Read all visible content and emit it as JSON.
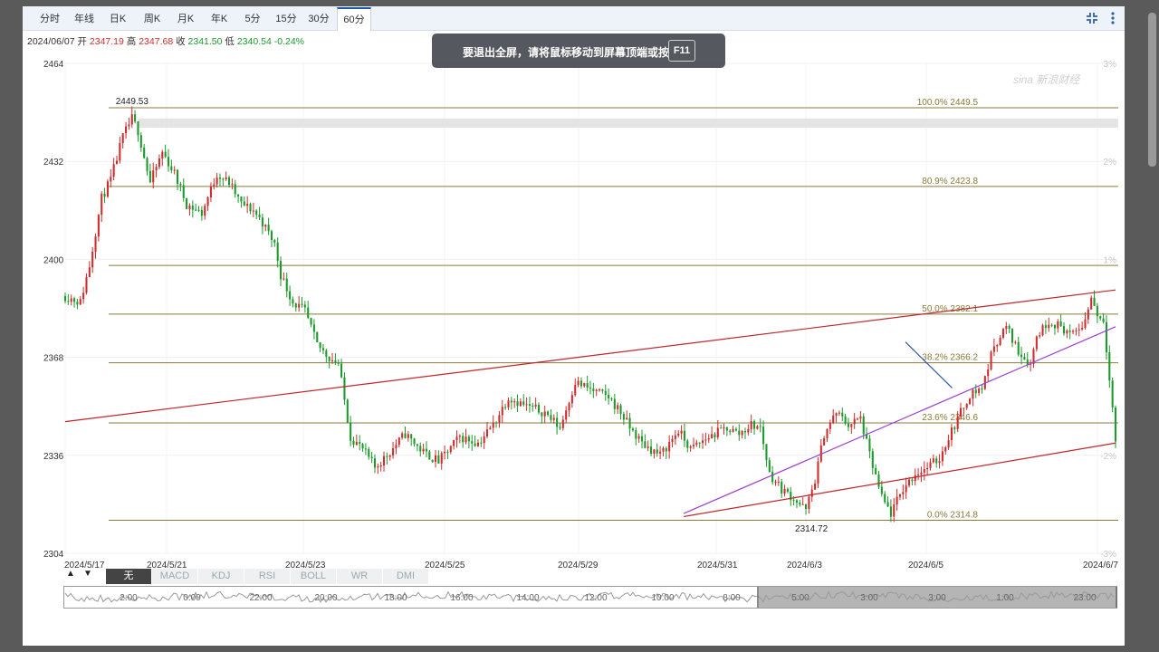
{
  "tabs": [
    {
      "label": "分时",
      "active": false
    },
    {
      "label": "年线",
      "active": false
    },
    {
      "label": "日K",
      "active": false
    },
    {
      "label": "周K",
      "active": false
    },
    {
      "label": "月K",
      "active": false
    },
    {
      "label": "年K",
      "active": false
    },
    {
      "label": "5分",
      "active": false
    },
    {
      "label": "15分",
      "active": false
    },
    {
      "label": "30分",
      "active": false
    },
    {
      "label": "60分",
      "active": true
    }
  ],
  "toolbar": {
    "icons": [
      "compress-icon",
      "more-vertical-icon"
    ]
  },
  "quote": {
    "date": "2024/06/07",
    "open_label": "开",
    "open": "2347.19",
    "high_label": "高",
    "high": "2347.68",
    "close_label": "收",
    "close": "2341.50",
    "low_label": "低",
    "low": "2340.54",
    "change": "-0.24%"
  },
  "fullscreen_toast": {
    "message": "要退出全屏，请将鼠标移动到屏幕顶端或按",
    "key": "F11"
  },
  "watermark": {
    "text": "sina 新浪财经"
  },
  "colors": {
    "up": "#d12b2b",
    "down": "#1a9a2a",
    "fib": "#8a7a3a",
    "channel": "#c0262b",
    "midline": "#9b3fd1",
    "blueline": "#2f55a4",
    "tab_accent": "#1e57a8"
  },
  "indicators": {
    "arrows": [
      "▲",
      "▼"
    ],
    "items": [
      {
        "label": "无",
        "active": true
      },
      {
        "label": "MACD",
        "active": false
      },
      {
        "label": "KDJ",
        "active": false
      },
      {
        "label": "RSI",
        "active": false
      },
      {
        "label": "BOLL",
        "active": false
      },
      {
        "label": "WR",
        "active": false
      },
      {
        "label": "DMI",
        "active": false
      }
    ]
  },
  "navigator": {
    "time_labels": [
      "2:00",
      "0:00",
      "22:00",
      "20:00",
      "18:00",
      "16:00",
      "14:00",
      "12:00",
      "10:00",
      "8:00",
      "5:00",
      "3:00",
      "3:00",
      "1:00",
      "23:00"
    ]
  },
  "chart_data": {
    "type": "candlestick",
    "ylim": [
      2304,
      2464
    ],
    "y_ticks": [
      2464,
      2432,
      2400,
      2368,
      2336,
      2304
    ],
    "pct_ticks": [
      {
        "label": "3%",
        "value": 2464
      },
      {
        "label": "2%",
        "value": 2432
      },
      {
        "label": "1%",
        "value": 2400
      },
      {
        "label": "-2%",
        "value": 2336
      },
      {
        "label": "-3%",
        "value": 2304
      }
    ],
    "x_labels": [
      "2024/5/17",
      "2024/5/21",
      "2024/5/23",
      "2024/5/25",
      "2024/5/29",
      "2024/5/31",
      "2024/6/3",
      "2024/6/5",
      "2024/6/7"
    ],
    "high_annotation": {
      "label": "2449.53",
      "value": 2449.53
    },
    "low_annotation": {
      "label": "2314.72",
      "value": 2314.72
    },
    "fib_levels": [
      {
        "label": "100.0% 2449.5",
        "value": 2449.5
      },
      {
        "label": "80.9% 2423.8",
        "value": 2423.8
      },
      {
        "label": "",
        "value": 2398
      },
      {
        "label": "50.0% 2382.1",
        "value": 2382.1
      },
      {
        "label": "38.2% 2366.2",
        "value": 2366.2
      },
      {
        "label": "23.6% 2346.6",
        "value": 2346.6
      },
      {
        "label": "0.0% 2314.8",
        "value": 2314.8
      }
    ],
    "grey_band": [
      2443,
      2446
    ],
    "anchors": [
      [
        0,
        2388
      ],
      [
        5,
        2386
      ],
      [
        8,
        2398
      ],
      [
        12,
        2420
      ],
      [
        15,
        2426
      ],
      [
        19,
        2440
      ],
      [
        22,
        2446
      ],
      [
        24,
        2442
      ],
      [
        28,
        2425
      ],
      [
        32,
        2435
      ],
      [
        36,
        2428
      ],
      [
        40,
        2418
      ],
      [
        45,
        2415
      ],
      [
        50,
        2428
      ],
      [
        54,
        2425
      ],
      [
        58,
        2418
      ],
      [
        62,
        2416
      ],
      [
        65,
        2412
      ],
      [
        69,
        2405
      ],
      [
        71,
        2395
      ],
      [
        75,
        2386
      ],
      [
        79,
        2383
      ],
      [
        83,
        2372
      ],
      [
        87,
        2368
      ],
      [
        90,
        2366
      ],
      [
        94,
        2342
      ],
      [
        98,
        2338
      ],
      [
        102,
        2332
      ],
      [
        106,
        2336
      ],
      [
        112,
        2343
      ],
      [
        118,
        2337
      ],
      [
        123,
        2334
      ],
      [
        130,
        2342
      ],
      [
        136,
        2340
      ],
      [
        141,
        2346
      ],
      [
        146,
        2355
      ],
      [
        152,
        2352
      ],
      [
        158,
        2350
      ],
      [
        163,
        2345
      ],
      [
        168,
        2360
      ],
      [
        174,
        2357
      ],
      [
        179,
        2355
      ],
      [
        183,
        2350
      ],
      [
        186,
        2345
      ],
      [
        190,
        2340
      ],
      [
        196,
        2336
      ],
      [
        202,
        2344
      ],
      [
        206,
        2338
      ],
      [
        212,
        2342
      ],
      [
        218,
        2345
      ],
      [
        222,
        2343
      ],
      [
        226,
        2346
      ],
      [
        229,
        2345
      ],
      [
        232,
        2330
      ],
      [
        236,
        2325
      ],
      [
        240,
        2322
      ],
      [
        244,
        2318
      ],
      [
        247,
        2328
      ],
      [
        250,
        2343
      ],
      [
        254,
        2350
      ],
      [
        258,
        2346
      ],
      [
        262,
        2348
      ],
      [
        265,
        2336
      ],
      [
        269,
        2322
      ],
      [
        272,
        2317
      ],
      [
        276,
        2325
      ],
      [
        280,
        2330
      ],
      [
        284,
        2332
      ],
      [
        288,
        2335
      ],
      [
        291,
        2342
      ],
      [
        294,
        2348
      ],
      [
        298,
        2356
      ],
      [
        302,
        2358
      ],
      [
        306,
        2372
      ],
      [
        310,
        2378
      ],
      [
        314,
        2370
      ],
      [
        318,
        2366
      ],
      [
        320,
        2375
      ],
      [
        324,
        2380
      ],
      [
        328,
        2378
      ],
      [
        332,
        2375
      ],
      [
        336,
        2380
      ],
      [
        338,
        2388
      ],
      [
        340,
        2382
      ],
      [
        342,
        2380
      ],
      [
        344,
        2362
      ],
      [
        346,
        2341
      ]
    ],
    "channel_upper": [
      [
        2024.0,
        2347
      ],
      [
        2024.9,
        2390.0
      ]
    ],
    "channel_lower": [
      [
        2024.53,
        2316
      ],
      [
        2024.9,
        2340.0
      ]
    ],
    "trend_lines": [
      {
        "color": "midline",
        "from": [
          2024.53,
          2317
        ],
        "to": [
          2024.9,
          2378
        ]
      },
      {
        "color": "blueline",
        "from": [
          2024.72,
          2373
        ],
        "to": [
          2024.76,
          2358
        ]
      }
    ]
  }
}
